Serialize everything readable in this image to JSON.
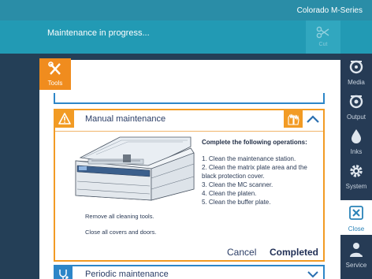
{
  "header": {
    "device_name": "Colorado M-Series",
    "status_text": "Maintenance in progress...",
    "cut_label": "Cut"
  },
  "tools_tab": {
    "label": "Tools"
  },
  "sidebar": {
    "items": [
      {
        "label": "Media",
        "icon": "media-roll-icon"
      },
      {
        "label": "Output",
        "icon": "output-icon"
      },
      {
        "label": "Inks",
        "icon": "ink-drop-icon"
      },
      {
        "label": "System",
        "icon": "gear-icon"
      },
      {
        "label": "Close",
        "icon": "close-x-icon",
        "active": true
      },
      {
        "label": "Service",
        "icon": "service-person-icon"
      }
    ]
  },
  "manual_card": {
    "title": "Manual maintenance",
    "instructions_heading": "Complete the following operations:",
    "steps": [
      "1. Clean the maintenance station.",
      "2. Clean the matrix plate area and the black protection cover.",
      "3. Clean the MC scanner.",
      "4. Clean the platen.",
      "5. Clean the buffer plate."
    ],
    "note_1": "Remove all cleaning tools.",
    "note_2": "Close all covers and doors.",
    "cancel_label": "Cancel",
    "completed_label": "Completed"
  },
  "periodic_card": {
    "title": "Periodic maintenance"
  },
  "colors": {
    "topbar": "#2a8da7",
    "statusbar": "#229ab4",
    "sidebar": "#263b55",
    "accent_orange": "#f29b24",
    "accent_blue": "#2d86c8"
  }
}
